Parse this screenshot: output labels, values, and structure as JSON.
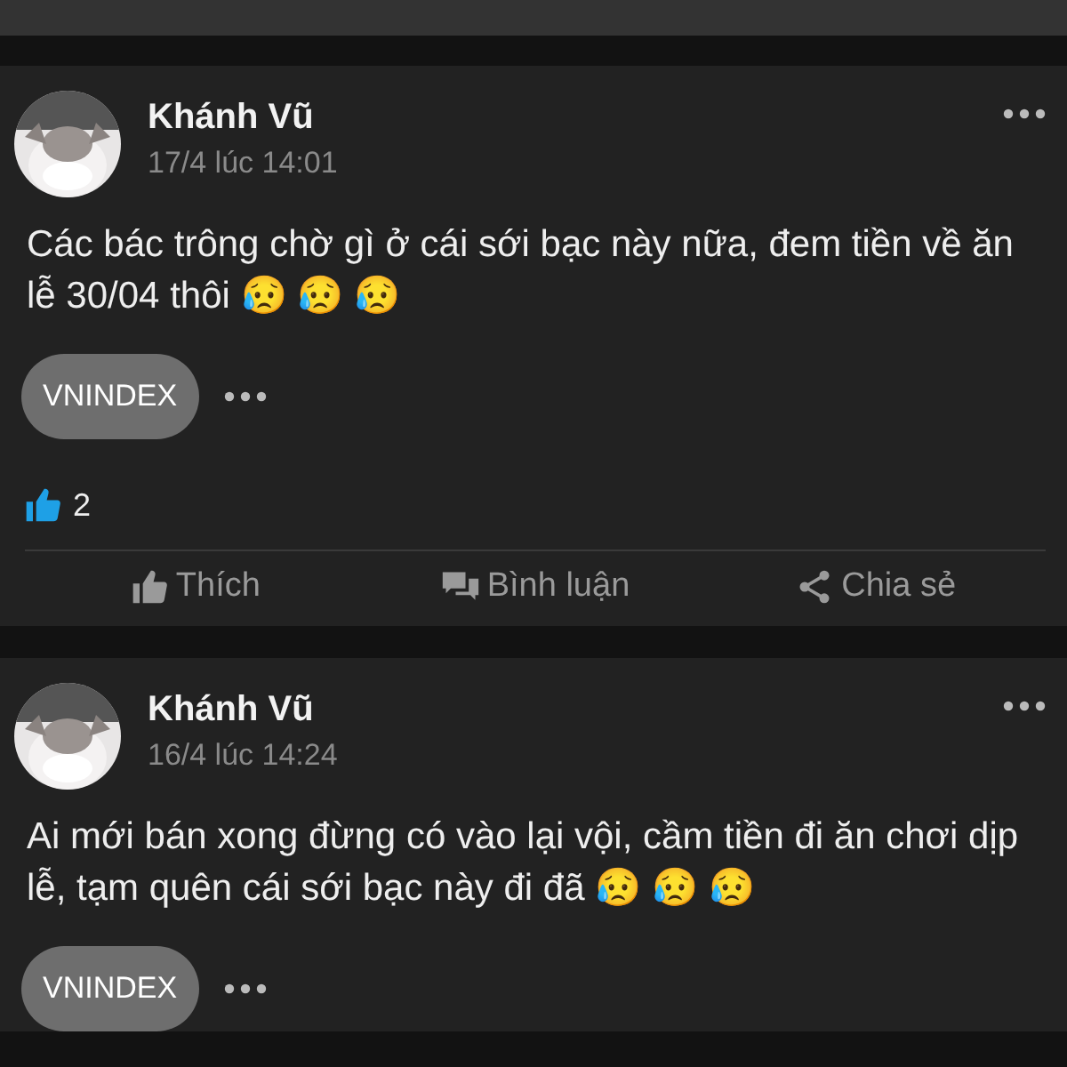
{
  "posts": [
    {
      "author": "Khánh Vũ",
      "time": "17/4 lúc 14:01",
      "text": "Các bác trông chờ gì ở cái sới bạc này nữa, đem tiền về ăn lễ 30/04 thôi 😥 😥 😥",
      "tag": "VNINDEX",
      "likes": "2",
      "actions": [
        {
          "kind": "like",
          "label": "Thích"
        },
        {
          "kind": "comment",
          "label": "Bình luận"
        },
        {
          "kind": "share",
          "label": "Chia sẻ"
        }
      ]
    },
    {
      "author": "Khánh Vũ",
      "time": "16/4 lúc 14:24",
      "text": "Ai mới bán xong đừng có vào lại vội, cầm tiền đi ăn chơi dịp lễ, tạm quên cái sới bạc này đi đã 😥 😥 😥",
      "tag": "VNINDEX"
    }
  ]
}
